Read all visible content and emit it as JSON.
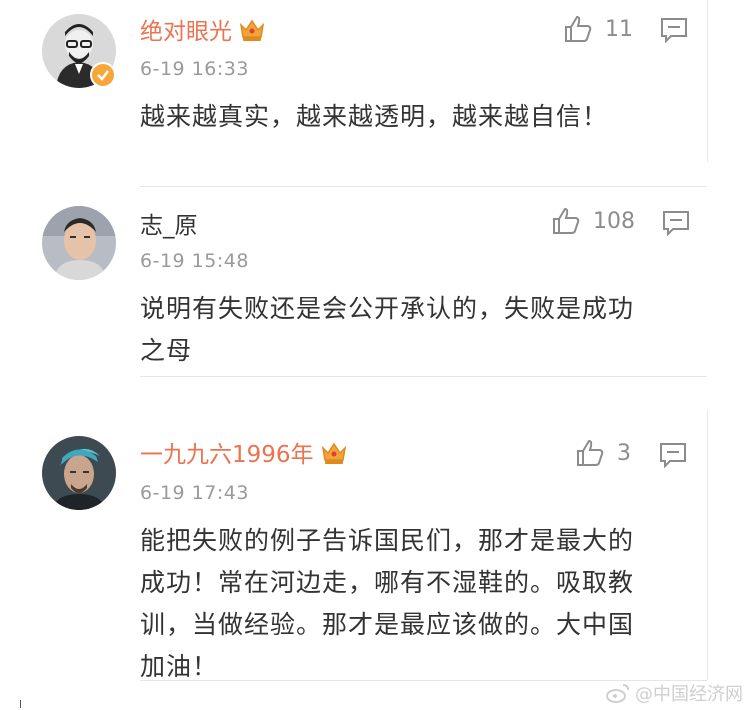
{
  "comments": [
    {
      "username": "绝对眼光",
      "has_crown": true,
      "verified": true,
      "time": "6-19 16:33",
      "likes": "11",
      "text_lines": [
        "越来越真实，越来越透明，越来越自信！"
      ],
      "avatar": "man-glasses-beard-avatar"
    },
    {
      "username": "志_原",
      "has_crown": false,
      "verified": false,
      "time": "6-19 15:48",
      "likes": "108",
      "text_lines": [
        "说明有失败还是会公开承认的，失败是成功",
        "之母"
      ],
      "avatar": "man-photo-avatar"
    },
    {
      "username": "一九九六1996年",
      "has_crown": true,
      "verified": false,
      "time": "6-19 17:43",
      "likes": "3",
      "text_lines": [
        "能把失败的例子告诉国民们，那才是最大的",
        "成功！常在河边走，哪有不湿鞋的。吸取教",
        "训，当做经验。那才是最应该做的。大中国",
        "加油！"
      ],
      "avatar": "man-blue-hair-avatar"
    }
  ],
  "watermark": "@中国经济网",
  "colors": {
    "vip_name": "#eb7350",
    "crown": "#f0a53c",
    "meta": "#9a9a9a",
    "icon": "#8c8c8c"
  }
}
